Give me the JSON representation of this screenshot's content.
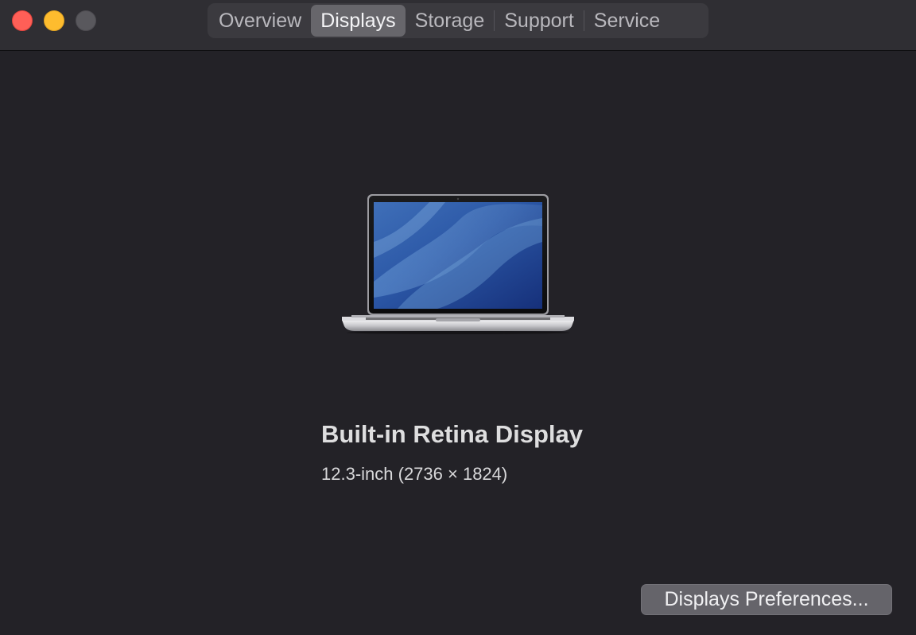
{
  "window": {
    "controls": [
      "close",
      "minimize",
      "zoom"
    ]
  },
  "tabs": [
    {
      "label": "Overview",
      "selected": false
    },
    {
      "label": "Displays",
      "selected": true
    },
    {
      "label": "Storage",
      "selected": false
    },
    {
      "label": "Support",
      "selected": false
    },
    {
      "label": "Service",
      "selected": false
    }
  ],
  "display": {
    "name": "Built-in Retina Display",
    "spec": "12.3-inch (2736 × 1824)",
    "icon": "laptop-icon"
  },
  "preferences_button": {
    "label": "Displays Preferences..."
  },
  "colors": {
    "background": "#232227",
    "titlebar": "#2f2e33",
    "close": "#ff5f57",
    "minimize": "#febc2e",
    "zoom_inactive": "#59585d",
    "selected_tab": "#67666b"
  }
}
